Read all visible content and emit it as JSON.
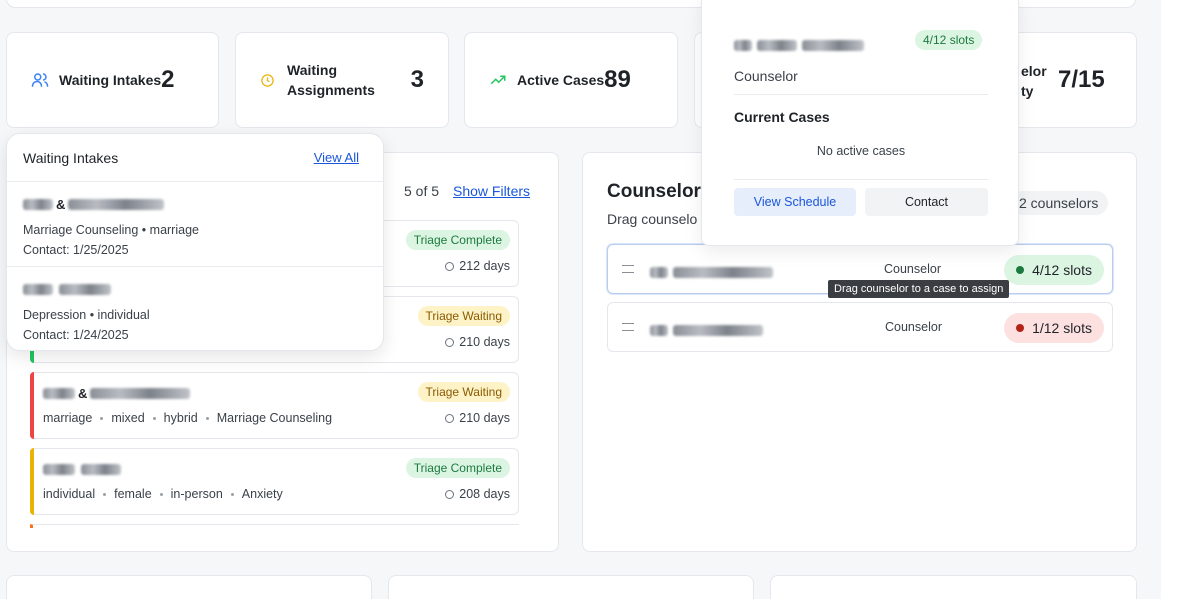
{
  "stats": [
    {
      "label": "Waiting Intakes",
      "value": "2",
      "icon": "users-icon",
      "color": "#3b82f6"
    },
    {
      "label": "Waiting Assignments",
      "value": "3",
      "icon": "clock-icon",
      "color": "#eab308"
    },
    {
      "label": "Active Cases",
      "value": "89",
      "icon": "trending-up-icon",
      "color": "#22c55e"
    },
    {
      "label_partial_1": "elor",
      "label_partial_2": "ty",
      "value": "7/15"
    }
  ],
  "cases_panel": {
    "count": "5 of 5",
    "show_filters": "Show Filters",
    "cases": [
      {
        "badge": "Triage Complete",
        "days": "212 days",
        "bar_color": "#22c55e"
      },
      {
        "badge": "Triage Waiting",
        "days": "210 days",
        "bar_color": "#22c55e"
      },
      {
        "badge": "Triage Waiting",
        "days": "210 days",
        "bar_color": "#ef4444",
        "tags": [
          "marriage",
          "mixed",
          "hybrid",
          "Marriage Counseling"
        ]
      },
      {
        "badge": "Triage Complete",
        "days": "208 days",
        "bar_color": "#eab308",
        "tags": [
          "individual",
          "female",
          "in-person",
          "Anxiety"
        ]
      }
    ]
  },
  "intakes_dropdown": {
    "title": "Waiting Intakes",
    "view_all": "View All",
    "items": [
      {
        "detail": "Marriage Counseling • marriage",
        "contact": "Contact: 1/25/2025"
      },
      {
        "detail": "Depression • individual",
        "contact": "Contact: 1/24/2025"
      }
    ]
  },
  "counselors_panel": {
    "title_partial": "Counselor",
    "subtitle_partial": "Drag counselo",
    "count_partial": "2 counselors",
    "rows": [
      {
        "role": "Counselor",
        "slots": "4/12 slots",
        "status_color": "#1c7a3e"
      },
      {
        "role": "Counselor",
        "slots": "1/12 slots",
        "status_color": "#b42318"
      }
    ],
    "tooltip": "Drag counselor to a case to assign"
  },
  "counselor_popover": {
    "slots": "4/12 slots",
    "role": "Counselor",
    "current_cases_title": "Current Cases",
    "no_cases": "No active cases",
    "view_schedule": "View Schedule",
    "contact": "Contact"
  }
}
